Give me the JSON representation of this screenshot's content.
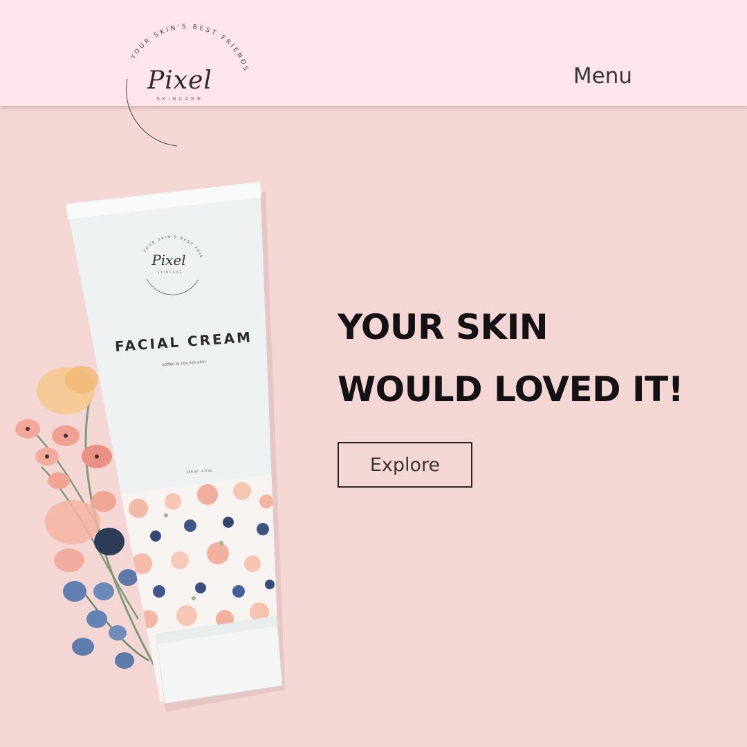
{
  "brand": {
    "name": "Pixel",
    "subtitle": "SKINCARE",
    "tagline": "YOUR SKIN'S BEST FRIENDS"
  },
  "nav": {
    "menu_label": "Menu"
  },
  "product": {
    "name": "FACIAL CREAM",
    "descriptor": "soften & nourish skin",
    "volume": "150 ml · 4 fl oz",
    "brand": "Pixel",
    "brand_sub": "SKINCARE",
    "tagline": "YOUR SKIN'S BEST FRIENDS"
  },
  "hero": {
    "headline_line1": "YOUR SKIN",
    "headline_line2": "WOULD LOVED IT!",
    "cta_label": "Explore"
  },
  "colors": {
    "page_background": "#f4d6d4",
    "header_background": "#fde5ec",
    "text_dark": "#141114",
    "tube_white": "#eef1f1"
  }
}
